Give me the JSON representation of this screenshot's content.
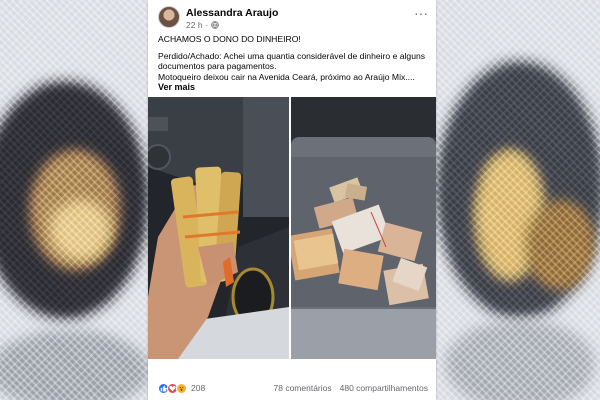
{
  "post": {
    "author": "Alessandra Araujo",
    "time": "22 h",
    "separator": "·",
    "headline": "ACHAMOS O DONO DO DINHEIRO!",
    "paragraph1": "Perdido/Achado: Achei uma quantia considerável de dinheiro e alguns documentos para pagamentos.",
    "paragraph2": "Motoqueiro deixou cair na Avenida Ceará, próximo ao Araújo Mix....",
    "see_more": "Ver mais"
  },
  "engagement": {
    "reaction_count": "208",
    "comments": "78 comentários",
    "shares": "480 compartilhamentos"
  },
  "icons": [
    "globe-icon",
    "more-options-icon",
    "like-reaction-icon",
    "love-reaction-icon",
    "wow-reaction-icon"
  ],
  "colors": {
    "facebook_blue": "#1877f2",
    "love_red": "#f33e58",
    "wow_yellow": "#f7b125",
    "meta_gray": "#65676b"
  }
}
